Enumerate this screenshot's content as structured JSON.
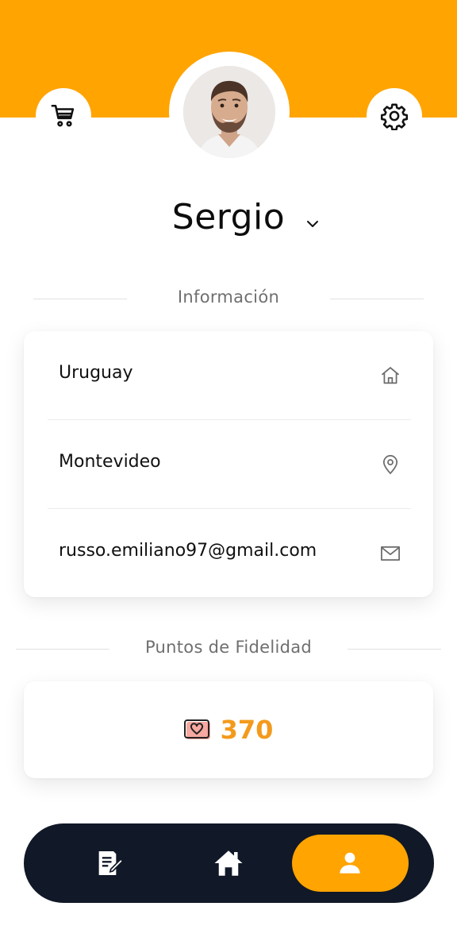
{
  "colors": {
    "accent": "#FFA400",
    "points": "#F39A1D",
    "nav_background": "#111827"
  },
  "header": {
    "left_icon": "shopping-cart-icon",
    "right_icon": "gear-icon"
  },
  "profile": {
    "name": "Sergio",
    "dropdown_icon": "chevron-down-icon"
  },
  "info": {
    "title": "Información",
    "rows": [
      {
        "value": "Uruguay",
        "icon": "home-icon"
      },
      {
        "value": "Montevideo",
        "icon": "location-pin-icon"
      },
      {
        "value": "russo.emiliano97@gmail.com",
        "icon": "mail-icon"
      }
    ]
  },
  "loyalty": {
    "title": "Puntos de Fidelidad",
    "points": "370",
    "icon": "heart-card-icon"
  },
  "bottom_nav": {
    "items": [
      {
        "icon": "notes-icon",
        "active": false
      },
      {
        "icon": "home-icon",
        "active": false
      },
      {
        "icon": "user-icon",
        "active": true
      }
    ]
  }
}
